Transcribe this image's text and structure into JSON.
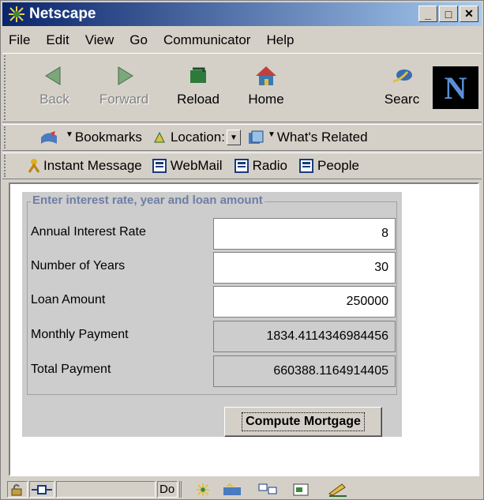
{
  "window": {
    "title": "Netscape"
  },
  "menu": [
    "File",
    "Edit",
    "View",
    "Go",
    "Communicator",
    "Help"
  ],
  "nav_toolbar": {
    "back": "Back",
    "forward": "Forward",
    "reload": "Reload",
    "home": "Home",
    "search": "Searc"
  },
  "location_toolbar": {
    "bookmarks": "Bookmarks",
    "location": "Location:",
    "whats_related": "What's Related"
  },
  "personal_toolbar": {
    "instant_message": "Instant Message",
    "webmail": "WebMail",
    "radio": "Radio",
    "people": "People"
  },
  "mortgage_form": {
    "legend": "Enter interest rate, year and loan amount",
    "rows": [
      {
        "label": "Annual Interest Rate",
        "value": "8"
      },
      {
        "label": "Number of Years",
        "value": "30"
      },
      {
        "label": "Loan Amount",
        "value": "250000"
      },
      {
        "label": "Monthly Payment",
        "value": "1834.4114346984456"
      },
      {
        "label": "Total Payment",
        "value": "660388.1164914405"
      }
    ],
    "compute_label": "Compute Mortgage"
  },
  "status_bar": {
    "doc_text": "Do"
  },
  "colors": {
    "titlebar_start": "#0a246a",
    "titlebar_end": "#a6caf0",
    "legend": "#6e7ea6"
  }
}
